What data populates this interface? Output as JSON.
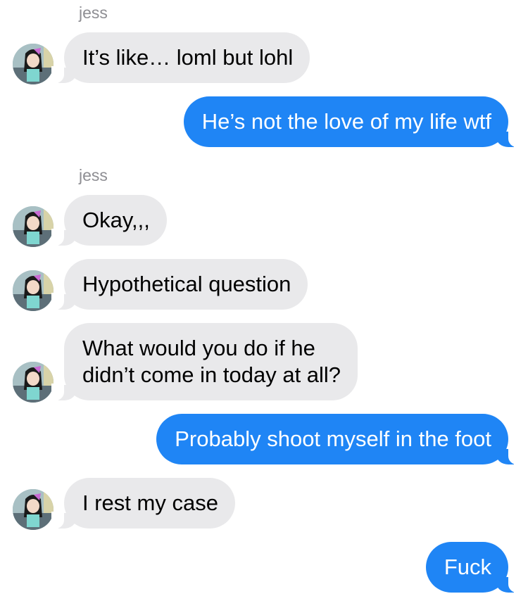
{
  "thread": {
    "messages": [
      {
        "sender": "jess",
        "direction": "incoming",
        "text": "It’s like… loml but lohl"
      },
      {
        "direction": "outgoing",
        "text": "He’s not the love of my life wtf"
      },
      {
        "sender": "jess",
        "direction": "incoming",
        "text": "Okay,,,"
      },
      {
        "direction": "incoming",
        "text": "Hypothetical question"
      },
      {
        "direction": "incoming",
        "text_lines": [
          "What would you do if he",
          "didn’t come in today at all?"
        ]
      },
      {
        "direction": "outgoing",
        "text": "Probably shoot myself in the foot"
      },
      {
        "direction": "incoming",
        "text": "I rest my case"
      },
      {
        "direction": "outgoing",
        "text": "Fuck"
      }
    ]
  },
  "colors": {
    "incoming_bubble": "#e9e9eb",
    "outgoing_bubble": "#1f85f5",
    "sender_label": "#8e8e93"
  },
  "icons": {
    "avatar": "cartoon-girl-avatar"
  }
}
